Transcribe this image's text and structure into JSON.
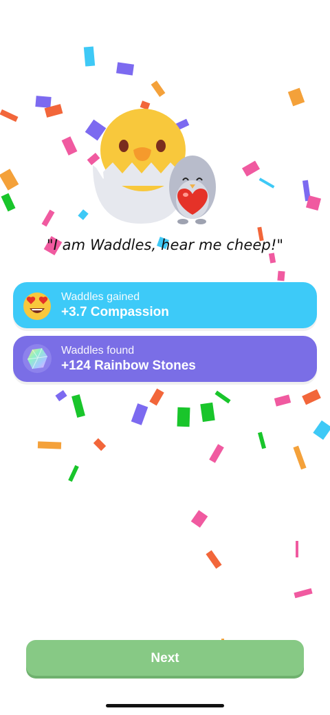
{
  "quote": "\"I am Waddles, hear me cheep!\"",
  "rewards": [
    {
      "caption": "Waddles gained",
      "value": "+3.7 Compassion",
      "icon": "heart-eyes-emoji-icon",
      "color": "#3dcaf8"
    },
    {
      "caption": "Waddles found",
      "value": "+124 Rainbow Stones",
      "icon": "rainbow-stone-icon",
      "color": "#7a6ee6"
    }
  ],
  "next_button": {
    "label": "Next",
    "color": "#87c985"
  },
  "confetti_colors": [
    "#7c6af0",
    "#f05aa0",
    "#f4a13a",
    "#3ec9f6",
    "#19c52b",
    "#f2663a"
  ]
}
